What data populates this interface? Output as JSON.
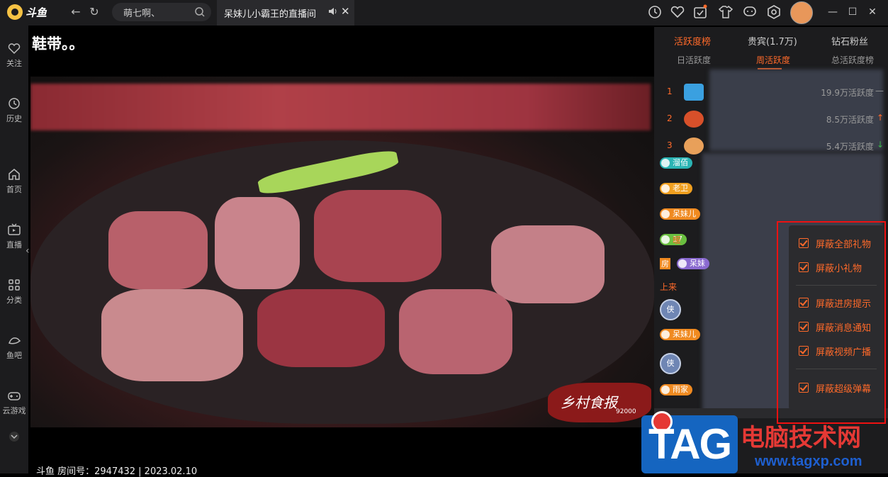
{
  "top": {
    "logo_text": "斗鱼",
    "search_value": "萌七啊、",
    "tab_title": "呆妹儿小霸王的直播间"
  },
  "sidebar": {
    "items": [
      {
        "label": "关注",
        "icon": "heart-icon"
      },
      {
        "label": "历史",
        "icon": "clock-icon"
      },
      {
        "label": "首页",
        "icon": "home-icon"
      },
      {
        "label": "直播",
        "icon": "tv-icon"
      },
      {
        "label": "分类",
        "icon": "grid-icon"
      },
      {
        "label": "鱼吧",
        "icon": "fish-icon"
      },
      {
        "label": "云游戏",
        "icon": "gamepad-icon"
      }
    ]
  },
  "video": {
    "caption": "鞋带。。",
    "stamp_text": "乡村食报",
    "stamp_number": "92000",
    "footer": "斗鱼 房间号：2947432 | 2023.02.10"
  },
  "rpanel": {
    "tabs": [
      "活跃度榜",
      "贵宾(1.7万)",
      "钻石粉丝"
    ],
    "subtabs": [
      "日活跃度",
      "周活跃度",
      "总活跃度榜"
    ],
    "rank": [
      {
        "num": "1",
        "value": "19.9万活跃度",
        "trend": "—",
        "color": "#999"
      },
      {
        "num": "2",
        "value": "8.5万活跃度",
        "trend": "↑",
        "color": "#ff6a2a"
      },
      {
        "num": "3",
        "value": "5.4万活跃度",
        "trend": "↓",
        "color": "#3bb54a"
      }
    ],
    "chat": [
      {
        "badge": "溜佰",
        "color": "#2ab4b4"
      },
      {
        "badge": "老卫",
        "color": "#f0a020"
      },
      {
        "badge": "呆妹儿",
        "color": "#f08a20"
      },
      {
        "badge": "17",
        "color": "#6abf40"
      },
      {
        "badge": "呆妹",
        "color": "#8a6ad0"
      },
      {
        "badge": "呆妹儿",
        "color": "#f08a20"
      },
      {
        "badge": "雨家",
        "color": "#f08a20"
      }
    ],
    "chat_text": {
      "warm": "暖",
      "house": "房",
      "online": "上来"
    }
  },
  "menu": {
    "items": [
      "屏蔽全部礼物",
      "屏蔽小礼物",
      "屏蔽进房提示",
      "屏蔽消息通知",
      "屏蔽视频广播",
      "屏蔽超级弹幕"
    ]
  },
  "watermark": {
    "tag": "TAG",
    "cn": "电脑技术网",
    "url": "www.tagxp.com"
  },
  "colors": {
    "accent": "#ff6a2a",
    "highlight_box": "#ee1111",
    "bg": "#1c1c1e"
  }
}
